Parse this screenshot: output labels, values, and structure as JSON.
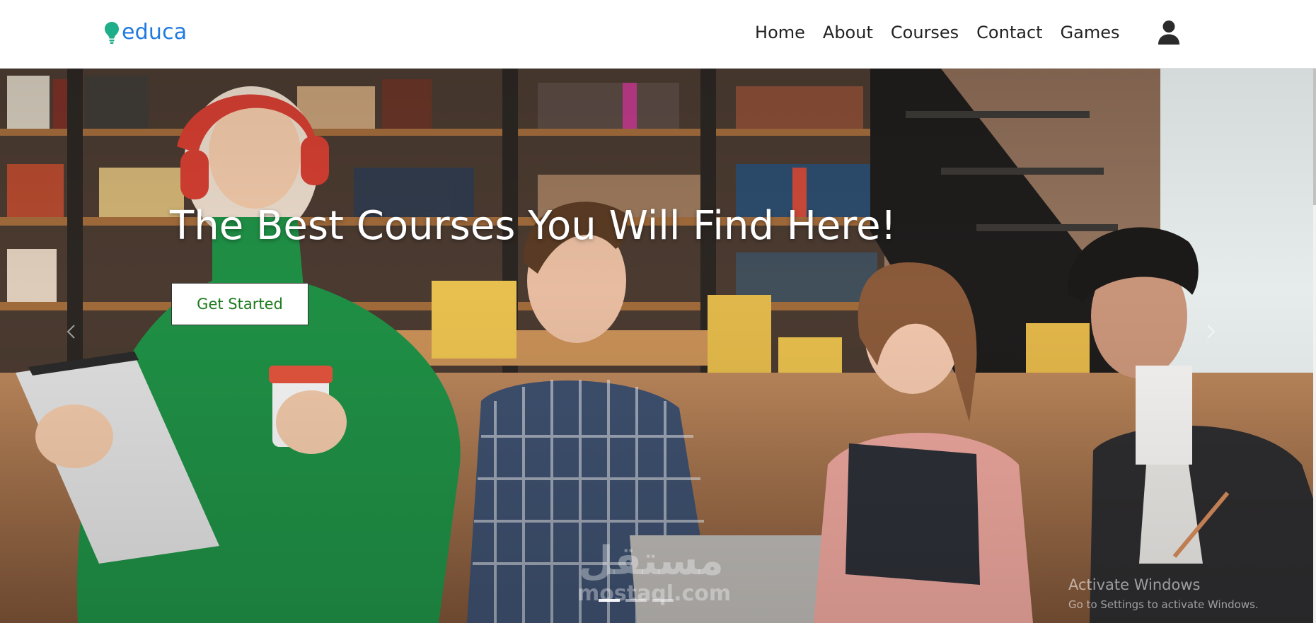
{
  "navbar": {
    "logo_text": "educa",
    "links": [
      {
        "label": "Home"
      },
      {
        "label": "About"
      },
      {
        "label": "Courses"
      },
      {
        "label": "Contact"
      },
      {
        "label": "Games"
      }
    ],
    "user_icon": "user-icon"
  },
  "hero": {
    "title": "The Best Courses You Will Find Here!",
    "cta_label": "Get Started",
    "prev_icon": "chevron-left-icon",
    "next_icon": "chevron-right-icon",
    "slide_count": 3,
    "active_slide": 1
  },
  "watermark": {
    "arabic": "مستقل",
    "latin": "mostaql.com"
  },
  "windows_notice": {
    "title": "Activate Windows",
    "subtitle": "Go to Settings to activate Windows."
  },
  "colors": {
    "logo": "#1f7ae0",
    "logo_icon": "#1eae8a",
    "cta_text": "#1d7a1d",
    "nav_text": "#222222"
  }
}
